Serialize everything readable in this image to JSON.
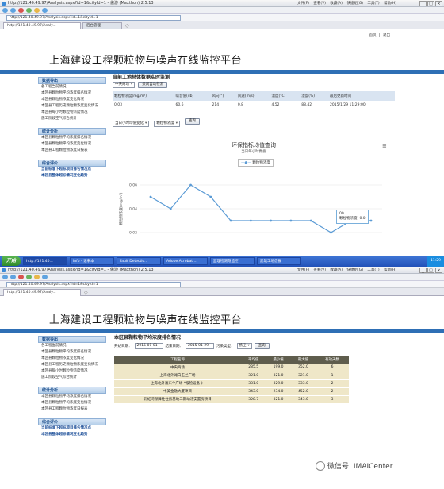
{
  "browser": {
    "url": "http://121.40.49.97/Analysis.aspx?id=1&cityId=1 - 傲游 (Maxthon) 2.5.13",
    "address": "http://121.40.49.97/Analysis.aspx?id=1&cityId=1",
    "menu": [
      "文件(F)",
      "查看(V)",
      "收藏(A)",
      "快捷组(G)",
      "工具(T)",
      "帮助(H)"
    ],
    "tabs": [
      "http://121.40.49.97/Analy...",
      "后台管理"
    ],
    "minimize": "_",
    "maximize": "□",
    "close": "×",
    "new_tab": "◇"
  },
  "site": {
    "title": "上海建设工程颗粒物与噪声在线监控平台",
    "top_links": "首页 | 退出"
  },
  "sidebar": {
    "sections": [
      {
        "title": "数据导出",
        "items": [
          "各工程当前情况",
          "本区县颗粒物平均浓度排名情况",
          "本区县颗粒物浓度变化情况",
          "本区县工程历史颗粒物浓度变化情况",
          "本区县每小时颗粒物浓度情况",
          "施工阶段空气综合统计"
        ]
      },
      {
        "title": "统计分析",
        "items": [
          "本区县颗粒物平均浓度排名情况",
          "本区县颗粒物平均浓度变化情况",
          "本区县工程颗粒物浓度日报表"
        ]
      },
      {
        "title": "综合评价",
        "items": [
          "当前标准下超标项目排名情况点",
          "本区县整体超标情况变化趋势"
        ]
      }
    ]
  },
  "screen1": {
    "section_title": "当前工地总体数据实时监测",
    "site_select": "中央商场",
    "close_btn": "关闭自动检测",
    "table": {
      "headers": [
        "颗粒物浓度(mg/m³)",
        "噪音值(db)",
        "风向(°)",
        "风速(m/s)",
        "温度(°C)",
        "湿度(%)",
        "最后更新时间"
      ],
      "row": [
        "0.03",
        "60.6",
        "214",
        "0.8",
        "4.52",
        "88.42",
        "2015/1/29 11:29:00"
      ]
    },
    "filter1": "当日小时均值变化",
    "filter2": "颗粒物浓度",
    "query_btn": "查询",
    "chart_menu": "≡",
    "tooltip_time": "09",
    "tooltip_label": "颗粒物浓度: 0.0"
  },
  "chart_data": {
    "type": "line",
    "title": "环保指标均值查询",
    "subtitle": "当日每小时数据",
    "ylabel": "颗粒物浓度(mg/m³)",
    "ylim": [
      0.01,
      0.07
    ],
    "yticks": [
      "0.06",
      "0.04",
      "0.02"
    ],
    "series": [
      {
        "name": "颗粒物浓度",
        "color": "#5b9bd5",
        "values": [
          0.05,
          0.04,
          0.06,
          0.05,
          0.03,
          0.03,
          0.03,
          0.03,
          0.03,
          0.02,
          0.03,
          0.03
        ]
      }
    ]
  },
  "screen2": {
    "section_title": "本区县颗粒物平均浓度排名情况",
    "start_label": "开始日期：",
    "start_value": "2015-01-01",
    "end_label": "结束日期：",
    "end_value": "2015-01-29",
    "type_label": "污染类型：",
    "type_value": "扬尘",
    "query_btn": "查询",
    "table": {
      "headers": [
        "工程名称",
        "平均值",
        "最小值",
        "最大值",
        "有效天数"
      ],
      "rows": [
        [
          "中央商场",
          "285.5",
          "199.0",
          "352.0",
          "6"
        ],
        [
          "上海北外滩白玉兰广场",
          "321.0",
          "321.0",
          "321.0",
          "1"
        ],
        [
          "上海北外滩东个广场 *报检设备 》",
          "331.0",
          "329.0",
          "333.0",
          "2"
        ],
        [
          "中美金融大厦项目",
          "343.0",
          "234.0",
          "452.0",
          "2"
        ],
        [
          "彩虹湾保障性住房基地二期动迁安置房项目",
          "328.7",
          "321.0",
          "343.0",
          "3"
        ]
      ]
    }
  },
  "taskbar": {
    "start": "开始",
    "tasks": [
      "http://121.40...",
      "info - 记事本",
      "Fault Detectio...",
      "Adobe Acrobat ...",
      "监理检测与监控",
      "建筑工地信报"
    ],
    "clock": "11:29"
  },
  "watermark": "微信号: IMAICenter"
}
